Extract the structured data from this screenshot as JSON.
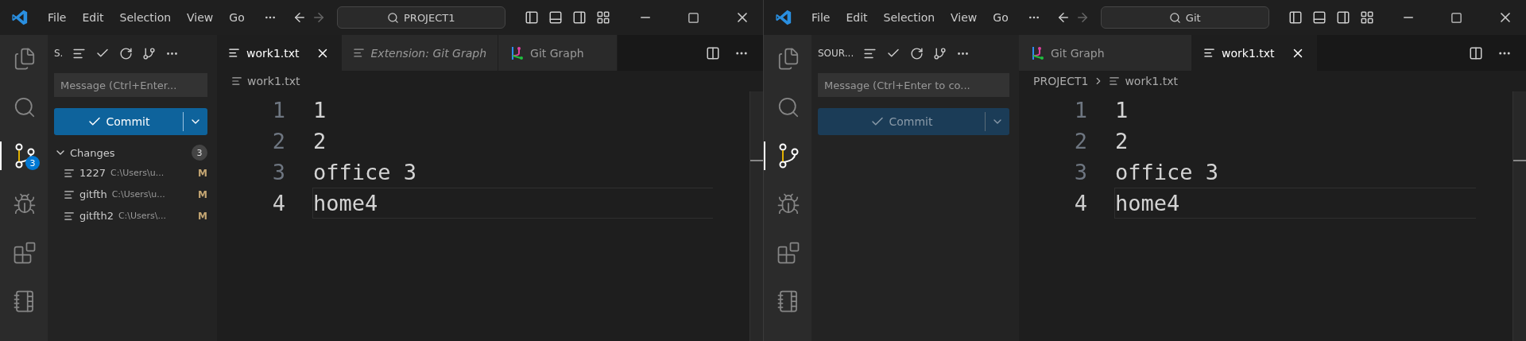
{
  "windows": [
    {
      "title_bar": {
        "menus": [
          "File",
          "Edit",
          "Selection",
          "View",
          "Go"
        ],
        "search": "PROJECT1"
      },
      "activity_bar": [
        {
          "kind": "explorer",
          "selected": false
        },
        {
          "kind": "search",
          "selected": false
        },
        {
          "kind": "source-control",
          "selected": true,
          "badge": "3"
        },
        {
          "kind": "run-debug",
          "selected": false
        },
        {
          "kind": "extensions",
          "selected": false
        },
        {
          "kind": "notebook",
          "selected": false
        }
      ],
      "sidebar": {
        "title": "S.",
        "message": {
          "placeholder": "Message (Ctrl+Enter..."
        },
        "commit": {
          "label": "Commit",
          "disabled": false
        },
        "changes": {
          "label": "Changes",
          "count": "3",
          "expanded": true,
          "files": [
            {
              "name": "1227",
              "path": "C:\\Users\\u...",
              "status": "M"
            },
            {
              "name": "gitfth",
              "path": "C:\\Users\\u...",
              "status": "M"
            },
            {
              "name": "gitfth2",
              "path": "C:\\Users\\...",
              "status": "M"
            }
          ]
        }
      },
      "tabs": [
        {
          "kind": "file",
          "label": "work1.txt",
          "selected": true,
          "preview": false
        },
        {
          "kind": "file",
          "label": "Extension: Git Graph",
          "selected": false,
          "preview": true
        },
        {
          "kind": "git-graph",
          "label": "Git Graph",
          "selected": false,
          "preview": false
        }
      ],
      "breadcrumbs": [
        {
          "kind": "file",
          "label": "work1.txt"
        }
      ],
      "editor": {
        "lines": [
          {
            "number": "1",
            "text": "1",
            "current": false
          },
          {
            "number": "2",
            "text": "2",
            "current": false
          },
          {
            "number": "3",
            "text": "office 3",
            "current": false
          },
          {
            "number": "4",
            "text": "home4",
            "current": true
          }
        ]
      }
    },
    {
      "title_bar": {
        "menus": [
          "File",
          "Edit",
          "Selection",
          "View",
          "Go"
        ],
        "search": "Git"
      },
      "activity_bar": [
        {
          "kind": "explorer",
          "selected": false
        },
        {
          "kind": "search",
          "selected": false
        },
        {
          "kind": "source-control",
          "selected": true
        },
        {
          "kind": "run-debug",
          "selected": false
        },
        {
          "kind": "extensions",
          "selected": false
        },
        {
          "kind": "notebook",
          "selected": false
        }
      ],
      "sidebar": {
        "title": "SOUR...",
        "message": {
          "placeholder": "Message (Ctrl+Enter to co..."
        },
        "commit": {
          "label": "Commit",
          "disabled": true
        }
      },
      "tabs": [
        {
          "kind": "git-graph",
          "label": "Git Graph",
          "selected": false,
          "preview": false
        },
        {
          "kind": "file",
          "label": "work1.txt",
          "selected": true,
          "preview": false
        }
      ],
      "breadcrumbs": [
        {
          "kind": "folder",
          "label": "PROJECT1"
        },
        {
          "kind": "file",
          "label": "work1.txt"
        }
      ],
      "editor": {
        "lines": [
          {
            "number": "1",
            "text": "1",
            "current": false
          },
          {
            "number": "2",
            "text": "2",
            "current": false
          },
          {
            "number": "3",
            "text": "office 3",
            "current": false
          },
          {
            "number": "4",
            "text": "home4",
            "current": true
          }
        ]
      }
    }
  ]
}
